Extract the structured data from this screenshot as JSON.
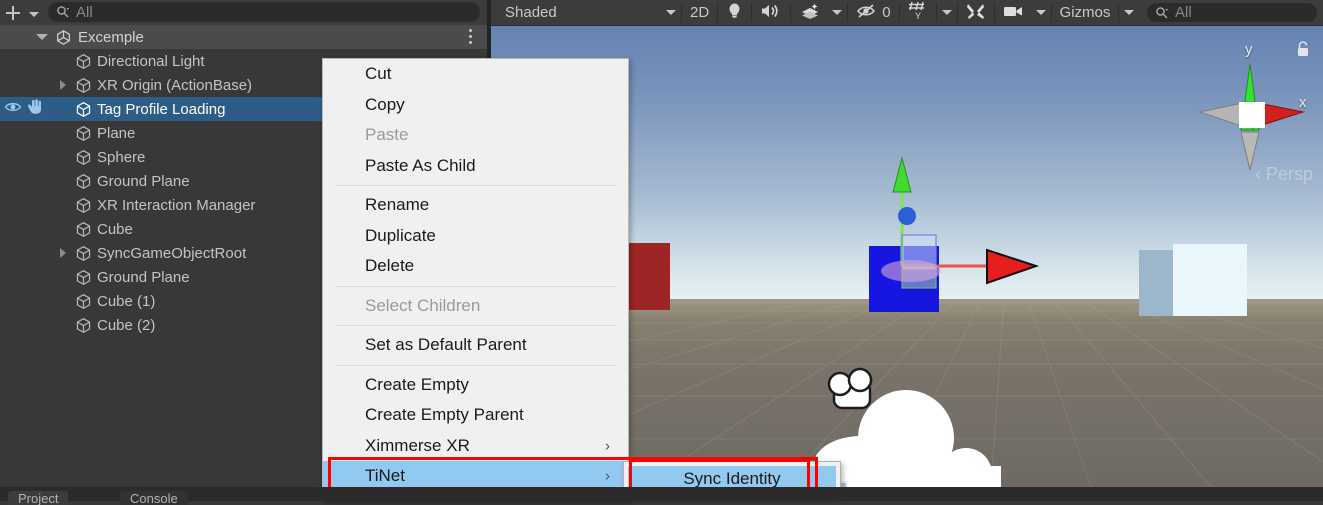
{
  "hierarchy": {
    "add_button": "+",
    "search": {
      "placeholder": "All",
      "value": ""
    },
    "scene_name": "Excemple",
    "items": [
      {
        "label": "Directional Light",
        "expandable": false,
        "selected": false
      },
      {
        "label": "XR Origin (ActionBase)",
        "expandable": true,
        "selected": false
      },
      {
        "label": "Tag Profile Loading",
        "expandable": false,
        "selected": true
      },
      {
        "label": "Plane",
        "expandable": false,
        "selected": false
      },
      {
        "label": "Sphere",
        "expandable": false,
        "selected": false
      },
      {
        "label": "Ground Plane",
        "expandable": false,
        "selected": false
      },
      {
        "label": "XR Interaction Manager",
        "expandable": false,
        "selected": false
      },
      {
        "label": "Cube",
        "expandable": false,
        "selected": false
      },
      {
        "label": "SyncGameObjectRoot",
        "expandable": true,
        "selected": false
      },
      {
        "label": "Ground Plane",
        "expandable": false,
        "selected": false
      },
      {
        "label": "Cube (1)",
        "expandable": false,
        "selected": false
      },
      {
        "label": "Cube (2)",
        "expandable": false,
        "selected": false
      }
    ]
  },
  "scene_toolbar": {
    "draw_mode": "Shaded",
    "two_d": "2D",
    "lighting_icon": "lightbulb-icon",
    "audio_icon": "speaker-icon",
    "fx_icon": "effects-icon",
    "hidden_objects_count": "0",
    "hidden_icon": "eye-crossed-icon",
    "grid_icon": "grid-snap-icon",
    "tools_icon": "tools-icon",
    "camera_icon": "camera-icon",
    "gizmos": "Gizmos",
    "search": {
      "placeholder": "All",
      "value": ""
    }
  },
  "scene_gizmo": {
    "axis_x": "x",
    "axis_y": "y",
    "projection": "Persp",
    "lock_icon": "lock-icon"
  },
  "context_menu": {
    "items": [
      {
        "label": "Cut",
        "type": "item",
        "disabled": false,
        "submenu": false,
        "highlighted": false
      },
      {
        "label": "Copy",
        "type": "item",
        "disabled": false,
        "submenu": false,
        "highlighted": false
      },
      {
        "label": "Paste",
        "type": "item",
        "disabled": true,
        "submenu": false,
        "highlighted": false
      },
      {
        "label": "Paste As Child",
        "type": "item",
        "disabled": false,
        "submenu": false,
        "highlighted": false
      },
      {
        "label": "",
        "type": "separator"
      },
      {
        "label": "Rename",
        "type": "item",
        "disabled": false,
        "submenu": false,
        "highlighted": false
      },
      {
        "label": "Duplicate",
        "type": "item",
        "disabled": false,
        "submenu": false,
        "highlighted": false
      },
      {
        "label": "Delete",
        "type": "item",
        "disabled": false,
        "submenu": false,
        "highlighted": false
      },
      {
        "label": "",
        "type": "separator"
      },
      {
        "label": "Select Children",
        "type": "item",
        "disabled": true,
        "submenu": false,
        "highlighted": false
      },
      {
        "label": "",
        "type": "separator"
      },
      {
        "label": "Set as Default Parent",
        "type": "item",
        "disabled": false,
        "submenu": false,
        "highlighted": false
      },
      {
        "label": "",
        "type": "separator"
      },
      {
        "label": "Create Empty",
        "type": "item",
        "disabled": false,
        "submenu": false,
        "highlighted": false
      },
      {
        "label": "Create Empty Parent",
        "type": "item",
        "disabled": false,
        "submenu": false,
        "highlighted": false
      },
      {
        "label": "Ximmerse XR",
        "type": "item",
        "disabled": false,
        "submenu": true,
        "highlighted": false
      },
      {
        "label": "TiNet",
        "type": "item",
        "disabled": false,
        "submenu": true,
        "highlighted": true
      }
    ],
    "submenu_arrow": "›"
  },
  "submenu": {
    "items": [
      {
        "label": "Sync Identity",
        "highlighted": true
      }
    ]
  },
  "annotations": {
    "highlight_color": "#ff0000",
    "boxes": [
      {
        "target": "TiNet menu item"
      },
      {
        "target": "Sync Identity submenu item"
      }
    ]
  },
  "bottom_tabs": [
    {
      "label": "Project"
    },
    {
      "label": "Console"
    }
  ],
  "scene_objects": [
    {
      "name": "red-cube",
      "color": "#e63232"
    },
    {
      "name": "blue-cube",
      "color": "#1616e0"
    },
    {
      "name": "white-cube",
      "color": "#e8f6fb"
    }
  ],
  "colors": {
    "panel_bg": "#383838",
    "toolbar_bg": "#3c3c3c",
    "selection_blue": "#2c5d87",
    "menu_bg": "#f0f0f0",
    "menu_highlight": "#92c9f0",
    "accent_red": "#ff0000",
    "axis_x": "#d93030",
    "axis_y": "#33dd33"
  }
}
